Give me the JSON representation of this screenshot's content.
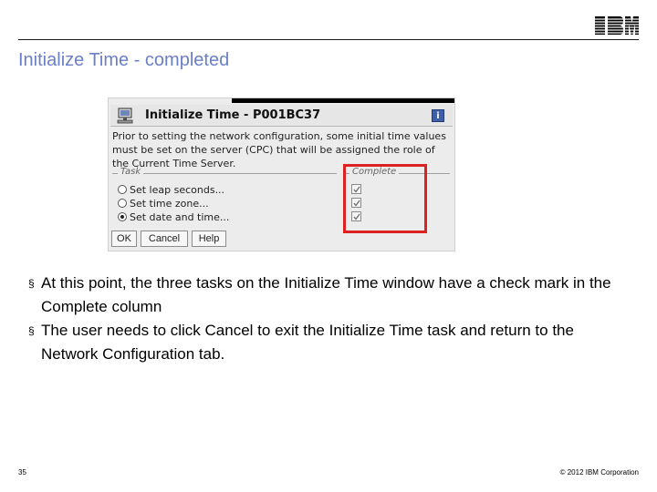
{
  "slide": {
    "logo_text": "IBM",
    "title": "Initialize Time - completed",
    "bullets": [
      "At this point, the three tasks on the Initialize Time window have a check mark in the Complete column",
      "The user needs to click Cancel to exit the Initialize Time task and return to the Network Configuration tab."
    ],
    "bullet_glyph": "§",
    "page_number": "35",
    "copyright": "© 2012 IBM Corporation"
  },
  "dialog": {
    "title": "Initialize Time - P001BC37",
    "info_icon": "i",
    "description": "Prior to setting the network configuration, some initial time values must be set on the server (CPC) that will be assigned the role of the Current Time Server.",
    "task_legend": "Task",
    "complete_legend": "Complete",
    "tasks": [
      {
        "label": "Set leap seconds...",
        "selected": false,
        "complete": true
      },
      {
        "label": "Set time zone...",
        "selected": false,
        "complete": true
      },
      {
        "label": "Set date and time...",
        "selected": true,
        "complete": true
      }
    ],
    "buttons": {
      "ok": "OK",
      "cancel": "Cancel",
      "help": "Help"
    }
  },
  "colors": {
    "title": "#6a7fc6",
    "highlight": "#dd2020",
    "info_icon": "#3f5fa8"
  },
  "icons": {
    "logo": "ibm-logo",
    "dialog": "computer-icon",
    "info": "info-icon",
    "check": "checkmark-icon",
    "bullet": "section-bullet-icon"
  }
}
